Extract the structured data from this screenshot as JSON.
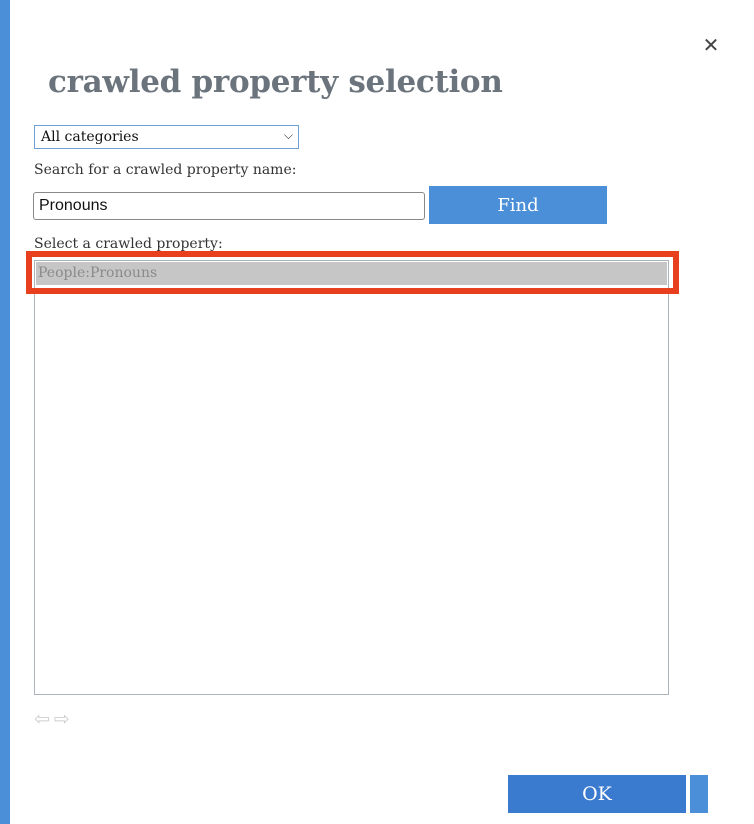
{
  "dialog": {
    "title": "crawled property selection",
    "close_glyph": "✕",
    "accent_color": "#4a8fd8",
    "highlight_color": "#e8401e"
  },
  "category_select": {
    "selected": "All categories",
    "chevron_glyph": "⌵"
  },
  "search": {
    "label": "Search for a crawled property name:",
    "value": "Pronouns",
    "find_label": "Find"
  },
  "list": {
    "label": "Select a crawled property:",
    "items": [
      {
        "label": "People:Pronouns",
        "selected": true
      }
    ]
  },
  "paging": {
    "prev_icon": "⇦",
    "next_icon": "⇨"
  },
  "footer": {
    "ok_label": "OK"
  }
}
